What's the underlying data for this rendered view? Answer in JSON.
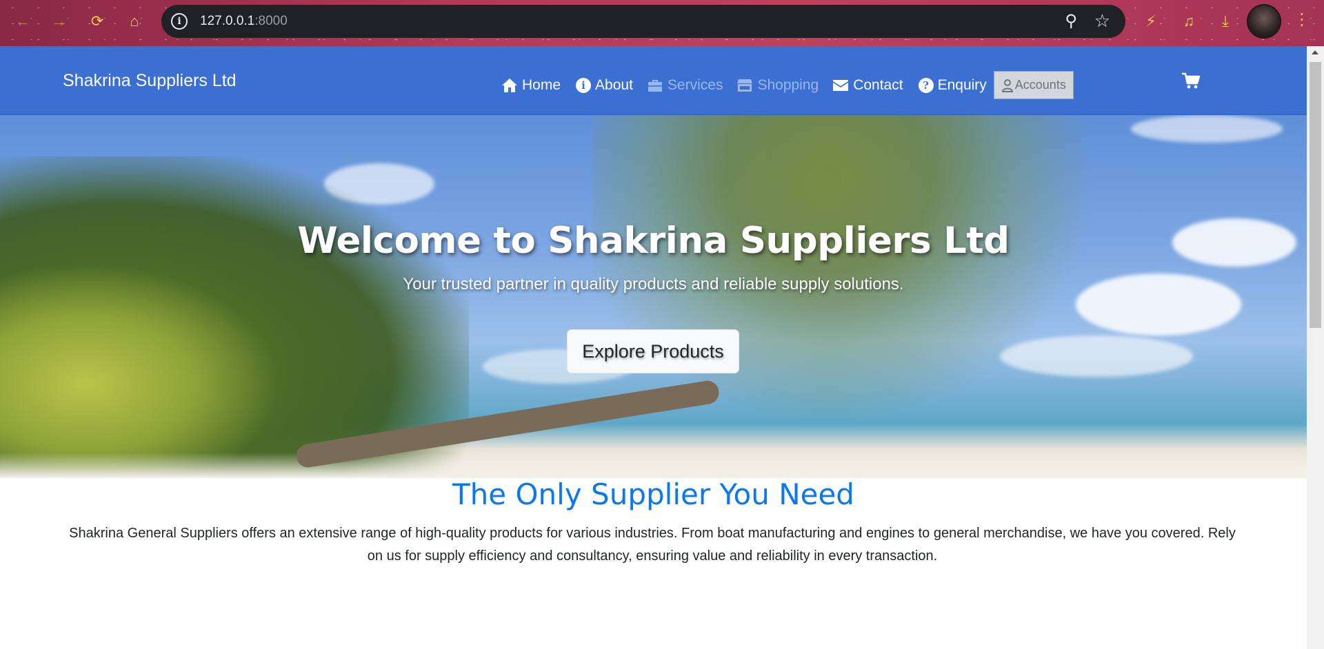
{
  "browser": {
    "url_host": "127.0.0.1",
    "url_port": ":8000",
    "icons": [
      "back-icon",
      "forward-icon",
      "reload-icon",
      "home-icon",
      "zoom-icon",
      "star-icon",
      "extension-icon",
      "media-icon",
      "download-icon",
      "profile-avatar",
      "menu-icon"
    ]
  },
  "navbar": {
    "brand": "Shakrina Suppliers Ltd",
    "items": [
      {
        "label": "Home",
        "icon": "home-icon"
      },
      {
        "label": "About",
        "icon": "info-icon"
      },
      {
        "label": "Services",
        "icon": "briefcase-icon"
      },
      {
        "label": "Shopping",
        "icon": "store-icon"
      },
      {
        "label": "Contact",
        "icon": "envelope-icon"
      },
      {
        "label": "Enquiry",
        "icon": "question-icon"
      }
    ],
    "accounts_label": "Accounts",
    "cart_icon": "cart-icon",
    "accent_color": "#3b6fd1"
  },
  "hero": {
    "title": "Welcome to Shakrina Suppliers Ltd",
    "subtitle": "Your trusted partner in quality products and reliable supply solutions.",
    "button_label": "Explore Products"
  },
  "about": {
    "title": "The Only Supplier You Need",
    "text": "Shakrina General Suppliers offers an extensive range of high-quality products for various industries. From boat manufacturing and engines to general merchandise, we have you covered. Rely on us for supply efficiency and consultancy, ensuring value and reliability in every transaction.",
    "title_color": "#0b78f0"
  }
}
